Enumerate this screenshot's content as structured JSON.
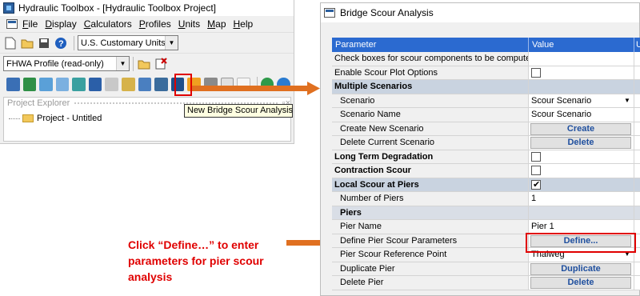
{
  "left_window": {
    "title": "Hydraulic Toolbox - [Hydraulic Toolbox Project]",
    "menu": [
      {
        "key": "F",
        "rest": "ile"
      },
      {
        "key": "D",
        "rest": "isplay"
      },
      {
        "key": "C",
        "rest": "alculators"
      },
      {
        "key": "P",
        "rest": "rofiles"
      },
      {
        "key": "U",
        "rest": "nits"
      },
      {
        "key": "M",
        "rest": "ap"
      },
      {
        "key": "H",
        "rest": "elp"
      }
    ],
    "units_combo": "U.S. Customary Units",
    "profile_combo": "FHWA Profile (read-only)",
    "explorer_title": "Project Explorer",
    "tree_item": "Project - Untitled",
    "tooltip": "New Bridge Scour Analysis"
  },
  "dialog": {
    "title": "Bridge Scour Analysis",
    "columns": [
      "Parameter",
      "Value",
      "U"
    ],
    "rows": [
      {
        "param": "Check boxes for scour components to be computed",
        "kind": "plain"
      },
      {
        "param": "Enable Scour Plot Options",
        "kind": "checkbox",
        "checked": false
      },
      {
        "param": "Multiple Scenarios",
        "kind": "section"
      },
      {
        "param": "Scenario",
        "kind": "dropdown",
        "value": "Scour Scenario"
      },
      {
        "param": "Scenario Name",
        "kind": "text",
        "value": "Scour Scenario"
      },
      {
        "param": "Create New Scenario",
        "kind": "button",
        "value": "Create"
      },
      {
        "param": "Delete Current Scenario",
        "kind": "button",
        "value": "Delete"
      },
      {
        "param": "Long Term Degradation",
        "kind": "bold-checkbox",
        "checked": false
      },
      {
        "param": "Contraction Scour",
        "kind": "bold-checkbox",
        "checked": false
      },
      {
        "param": "Local Scour at Piers",
        "kind": "section-checkbox",
        "checked": true
      },
      {
        "param": "Number of Piers",
        "kind": "text",
        "value": "1"
      },
      {
        "param": "Piers",
        "kind": "subsection"
      },
      {
        "param": "Pier Name",
        "kind": "text",
        "value": "Pier 1"
      },
      {
        "param": "Define Pier Scour Parameters",
        "kind": "button",
        "value": "Define..."
      },
      {
        "param": "Pier Scour Reference Point",
        "kind": "dropdown",
        "value": "Thalweg"
      },
      {
        "param": "Duplicate Pier",
        "kind": "button",
        "value": "Duplicate"
      },
      {
        "param": "Delete Pier",
        "kind": "button",
        "value": "Delete"
      }
    ]
  },
  "annotation": {
    "caption": "Click “Define…” to enter parameters for pier scour analysis",
    "accent_color": "#e00000",
    "arrow_color": "#e07020"
  }
}
